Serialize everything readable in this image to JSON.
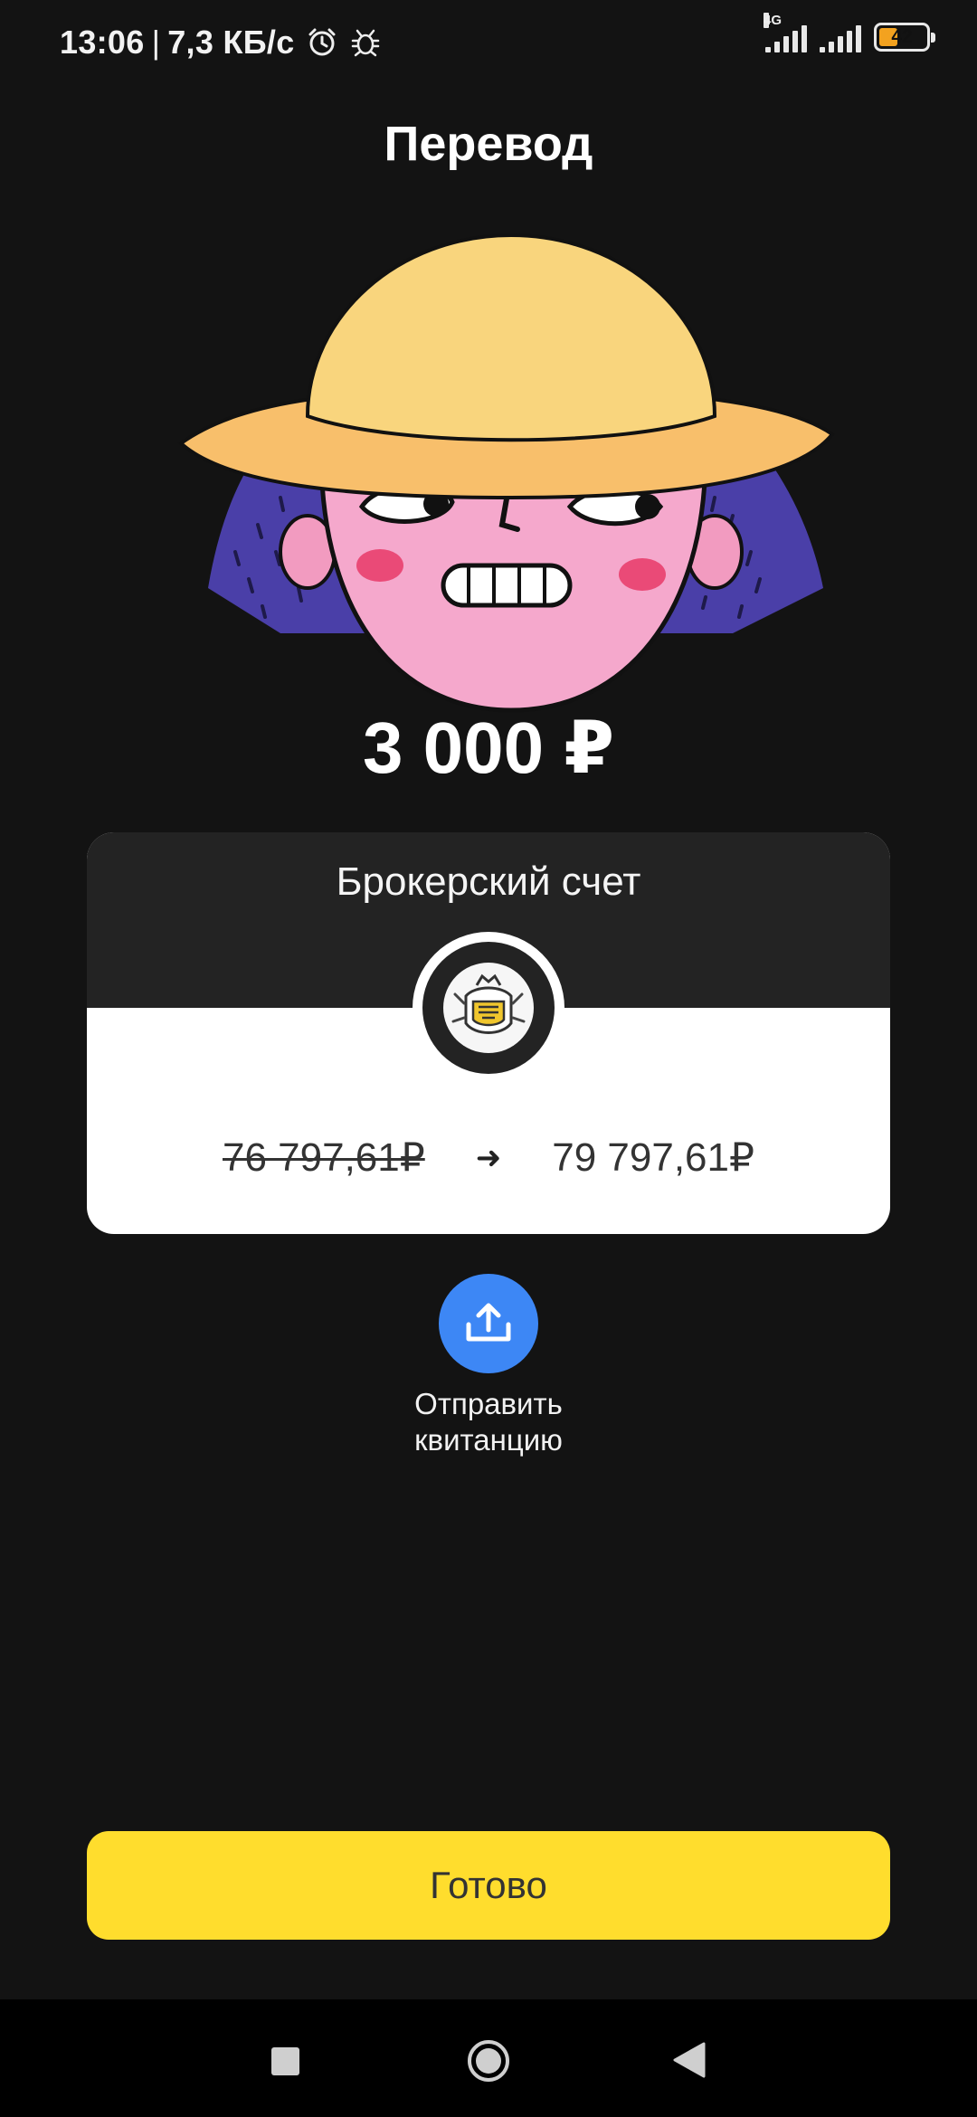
{
  "status_bar": {
    "time": "13:06",
    "separator": "|",
    "speed": "7,3 КБ/с",
    "network_type": "4G",
    "battery_level": "42",
    "icons": [
      "alarm-icon",
      "bug-icon",
      "signal-icon",
      "signal-icon",
      "battery-icon"
    ]
  },
  "header": {
    "title": "Перевод"
  },
  "transfer": {
    "amount": "3 000 ₽"
  },
  "account_card": {
    "title": "Брокерский счет",
    "old_balance": "76 797,61₽",
    "arrow": "➜",
    "new_balance": "79 797,61₽",
    "logo_icon": "bank-emblem-icon"
  },
  "share": {
    "icon": "share-upload-icon",
    "label_line1": "Отправить",
    "label_line2": "квитанцию",
    "accent_color": "#3d87f5"
  },
  "done_button": {
    "label": "Готово",
    "color": "#ffdd2d"
  },
  "nav_bar": {
    "icons": [
      "recents-square-icon",
      "home-circle-icon",
      "back-triangle-icon"
    ]
  }
}
